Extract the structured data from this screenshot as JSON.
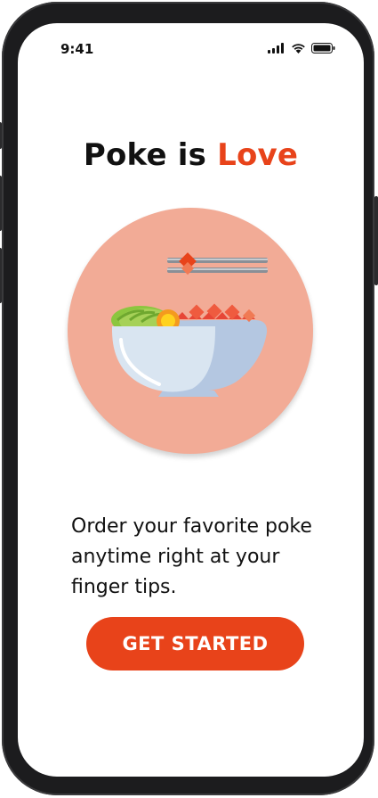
{
  "status_bar": {
    "time": "9:41",
    "icons": [
      "cellular-signal-icon",
      "wifi-icon",
      "battery-icon"
    ]
  },
  "headline": {
    "main": "Poke is ",
    "accent": "Love",
    "accent_color": "#e8431a"
  },
  "hero": {
    "illustration": "poke-bowl-with-chopsticks",
    "circle_color": "#f2ab96"
  },
  "description": "Order your favorite poke anytime right at your finger tips.",
  "cta": {
    "label": "GET STARTED",
    "color": "#e8431a"
  }
}
